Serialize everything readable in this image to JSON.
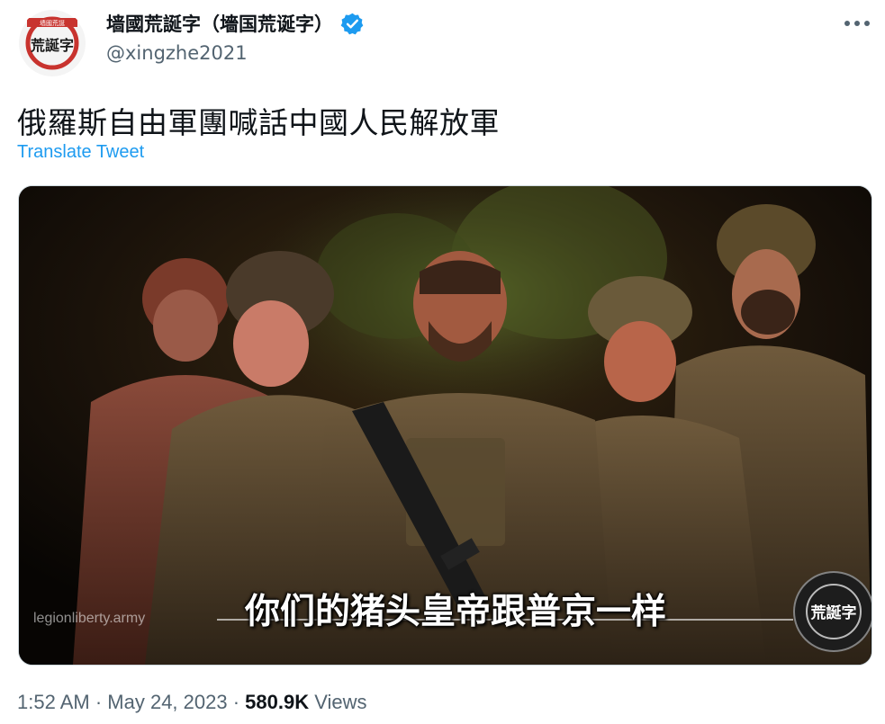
{
  "author": {
    "display_name": "墙國荒誕字（墻国荒诞字）",
    "handle": "@xingzhe2021",
    "verified": true,
    "avatar_text": "荒誕字",
    "avatar_small_text": "墙國荒誕"
  },
  "tweet": {
    "text": "俄羅斯自由軍團喊話中國人民解放軍",
    "translate_label": "Translate Tweet"
  },
  "media": {
    "subtitle": "你们的猪头皇帝跟普京一样",
    "watermark": "legionliberty.army",
    "logo_text": "荒誕字"
  },
  "meta": {
    "time": "1:52 AM",
    "separator": " · ",
    "date": "May 24, 2023",
    "views_count": "580.9K",
    "views_label": " Views"
  },
  "colors": {
    "accent": "#1d9bf0",
    "text_primary": "#0f1419",
    "text_secondary": "#536471"
  },
  "icons": [
    "verified-badge-icon",
    "more-options-icon"
  ]
}
